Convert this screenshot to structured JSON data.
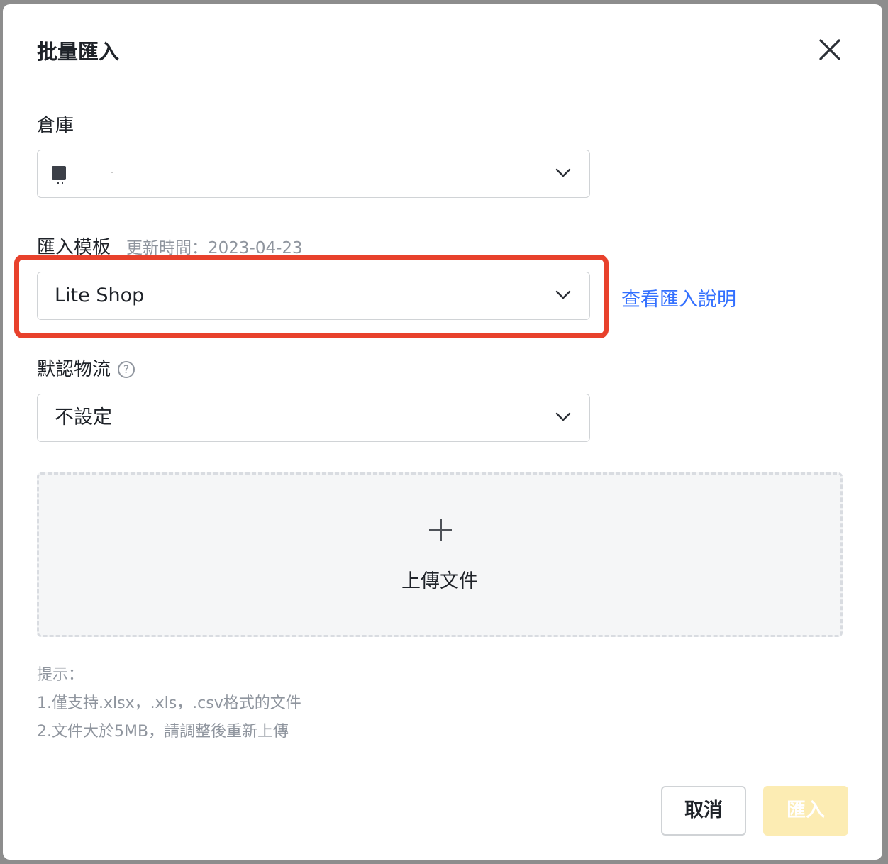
{
  "dialog": {
    "title": "批量匯入",
    "close_icon": "close-icon"
  },
  "warehouse": {
    "label": "倉庫",
    "value": ""
  },
  "template": {
    "label": "匯入模板",
    "updated": "更新時間：2023-04-23",
    "value": "Lite Shop",
    "help_link": "查看匯入說明"
  },
  "logistics": {
    "label": "默認物流",
    "help_icon": "?",
    "value": "不設定"
  },
  "upload": {
    "label": "上傳文件",
    "icon": "plus-icon"
  },
  "tips": {
    "title": "提示：",
    "line1": "1.僅支持.xlsx，.xls，.csv格式的文件",
    "line2": "2.文件大於5MB，請調整後重新上傳"
  },
  "footer": {
    "cancel_label": "取消",
    "import_label": "匯入"
  },
  "colors": {
    "highlight": "#e8412c",
    "link": "#3370ff",
    "primary_disabled": "#fcecb3"
  }
}
